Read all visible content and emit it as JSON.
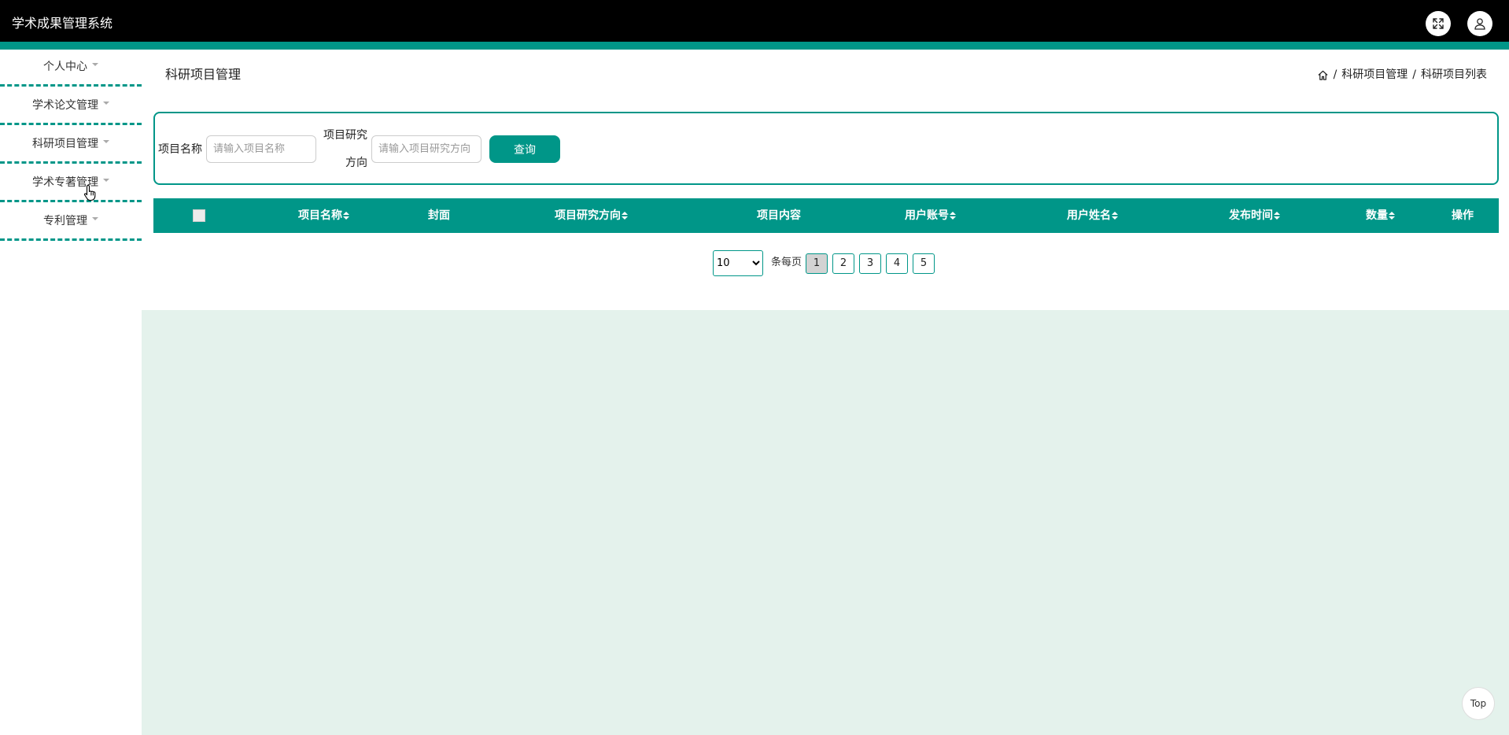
{
  "app": {
    "title": "学术成果管理系统"
  },
  "header": {
    "fullscreen_icon": "fullscreen-icon",
    "user_icon": "user-icon"
  },
  "sidebar": {
    "items": [
      {
        "label": "个人中心"
      },
      {
        "label": "学术论文管理"
      },
      {
        "label": "科研项目管理"
      },
      {
        "label": "学术专著管理"
      },
      {
        "label": "专利管理"
      }
    ]
  },
  "page": {
    "title": "科研项目管理",
    "breadcrumb": {
      "home_icon": "home-icon",
      "sep": "/",
      "level1": "科研项目管理",
      "level2": "科研项目列表"
    }
  },
  "search": {
    "name_label": "项目名称",
    "name_placeholder": "请输入项目名称",
    "direction_label_line1": "项目研究",
    "direction_label_line2": "方向",
    "direction_placeholder": "请输入项目研究方向",
    "query_label": "查询"
  },
  "table": {
    "columns": [
      "项目名称",
      "封面",
      "项目研究方向",
      "项目内容",
      "用户账号",
      "用户姓名",
      "发布时间",
      "数量",
      "操作"
    ]
  },
  "pagination": {
    "page_size": "10",
    "page_size_options": [
      "10"
    ],
    "per_page_label": "条每页",
    "pages": [
      "1",
      "2",
      "3",
      "4",
      "5"
    ],
    "current_page": "1"
  },
  "back_to_top": {
    "label": "Top"
  },
  "colors": {
    "accent": "#009688",
    "topbar": "#000000",
    "content_bg": "#e4f2ec",
    "active_page": "#d3d3d3"
  }
}
